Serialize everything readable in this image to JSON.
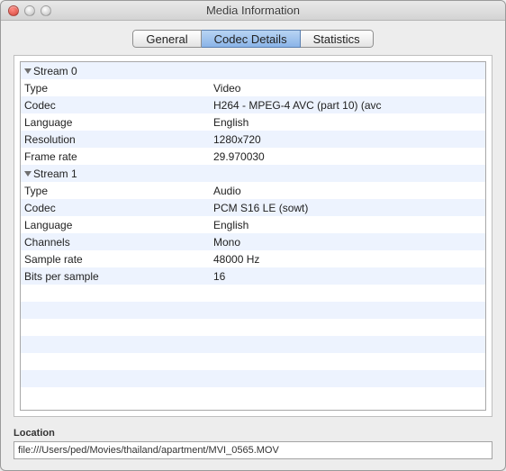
{
  "window": {
    "title": "Media Information"
  },
  "tabs": {
    "general": "General",
    "codec": "Codec Details",
    "stats": "Statistics",
    "active": "codec"
  },
  "streams": [
    {
      "header": "Stream 0",
      "rows": [
        {
          "k": "Type",
          "v": "Video"
        },
        {
          "k": "Codec",
          "v": "H264 - MPEG-4 AVC (part 10) (avc"
        },
        {
          "k": "Language",
          "v": "English"
        },
        {
          "k": "Resolution",
          "v": "1280x720"
        },
        {
          "k": "Frame rate",
          "v": "29.970030"
        }
      ]
    },
    {
      "header": "Stream 1",
      "rows": [
        {
          "k": "Type",
          "v": "Audio"
        },
        {
          "k": "Codec",
          "v": "PCM S16 LE (sowt)"
        },
        {
          "k": "Language",
          "v": "English"
        },
        {
          "k": "Channels",
          "v": "Mono"
        },
        {
          "k": "Sample rate",
          "v": "48000 Hz"
        },
        {
          "k": "Bits per sample",
          "v": "16"
        }
      ]
    }
  ],
  "filler_rows": 7,
  "location": {
    "label": "Location",
    "value": "file:///Users/ped/Movies/thailand/apartment/MVI_0565.MOV"
  }
}
